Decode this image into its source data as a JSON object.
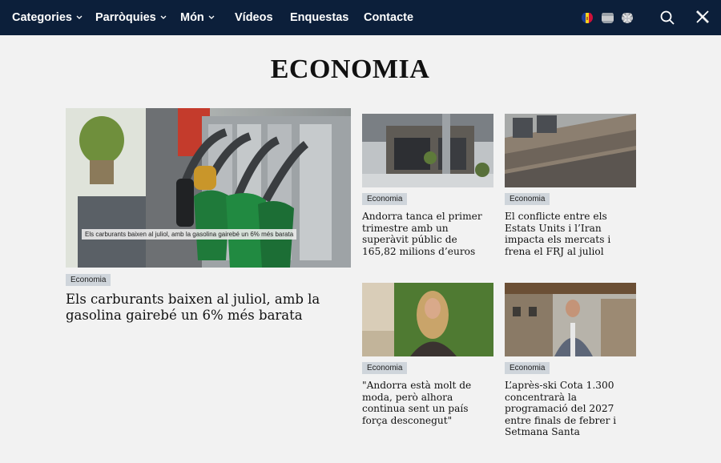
{
  "nav": {
    "items": [
      {
        "label": "Categories",
        "has_dropdown": true
      },
      {
        "label": "Parròquies",
        "has_dropdown": true
      },
      {
        "label": "Món",
        "has_dropdown": true
      },
      {
        "label": "Vídeos",
        "has_dropdown": false
      },
      {
        "label": "Enquestas",
        "has_dropdown": false
      },
      {
        "label": "Contacte",
        "has_dropdown": false
      }
    ],
    "languages": [
      "andorra-flag-icon",
      "spain-flag-icon",
      "uk-flag-icon"
    ],
    "search_icon": "search-icon",
    "x_icon": "x-social-icon"
  },
  "page": {
    "title": "ECONOMIA"
  },
  "featured": {
    "category": "Economia",
    "image_caption": "Els carburants baixen al juliol, amb la gasolina gairebé un 6% més barata",
    "headline": "Els carburants baixen al juliol, amb la gasolina gairebé un 6% més barata"
  },
  "articles": [
    {
      "category": "Economia",
      "headline": "Andorra tanca el primer trimestre amb un superàvit públic de 165,82 milions d’euros"
    },
    {
      "category": "Economia",
      "headline": "El conflicte entre els Estats Units i l’Iran impacta els mercats i frena el FRJ al juliol"
    },
    {
      "category": "Economia",
      "headline": "\"Andorra està molt de moda, però alhora continua sent un país força desconegut\""
    },
    {
      "category": "Economia",
      "headline": "L’après-ski Cota 1.300 concentrarà la programació del 2027 entre finals de febrer i Setmana Santa"
    }
  ],
  "colors": {
    "nav_bg": "#0c1f3a",
    "tag_bg": "#cfd5db",
    "page_bg": "#f2f2f2"
  }
}
